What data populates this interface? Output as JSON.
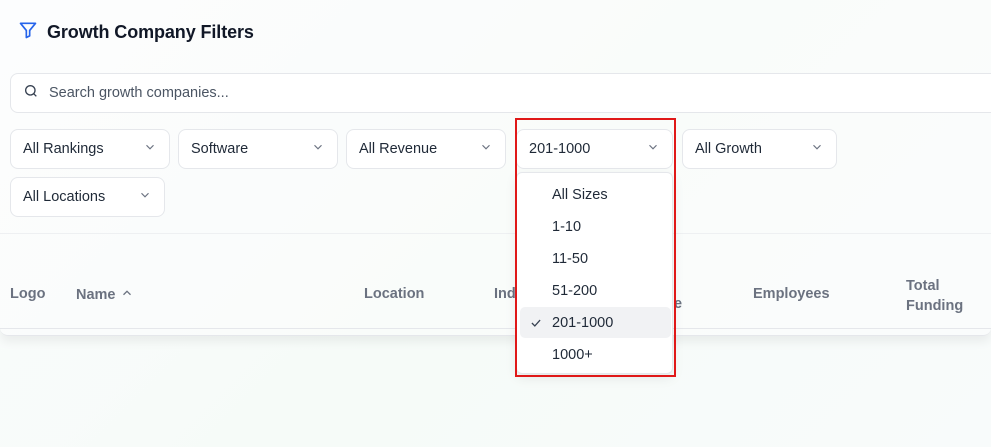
{
  "header": {
    "title": "Growth Company Filters",
    "icon": "filter-icon"
  },
  "search": {
    "placeholder": "Search growth companies...",
    "value": ""
  },
  "filters": {
    "rankings": "All Rankings",
    "industry": "Software",
    "revenue": "All Revenue",
    "size": "201-1000",
    "growth": "All Growth",
    "locations": "All Locations"
  },
  "size_dropdown": {
    "options": [
      "All Sizes",
      "1-10",
      "11-50",
      "51-200",
      "201-1000",
      "1000+"
    ],
    "selected": "201-1000"
  },
  "table": {
    "columns": {
      "logo": "Logo",
      "name": "Name",
      "location": "Location",
      "industry_partial": "Ind",
      "revenue_partial": "e",
      "employees": "Employees",
      "total_funding_line1": "Total",
      "total_funding_line2": "Funding"
    },
    "sort": {
      "column": "Name",
      "direction": "ascending"
    }
  },
  "colors": {
    "accent": "#2563eb",
    "highlight": "#e01818"
  }
}
